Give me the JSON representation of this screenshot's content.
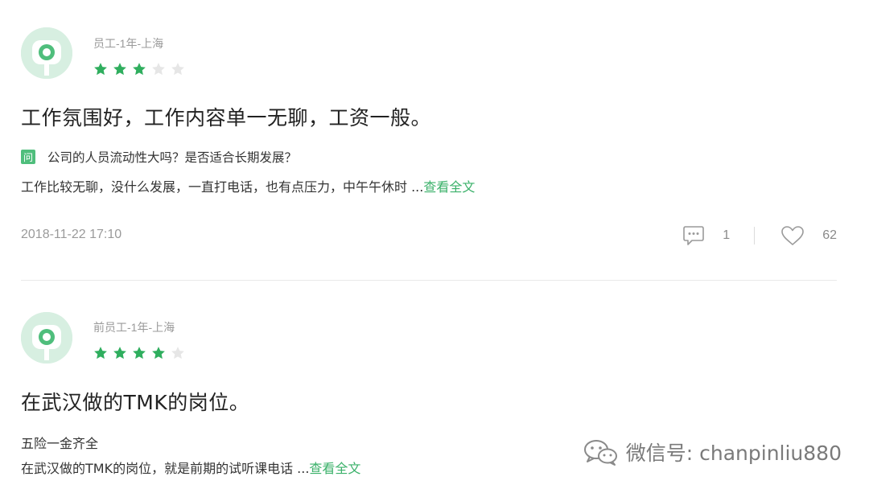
{
  "colors": {
    "accent": "#3bb16a",
    "star_on": "#2fae5e",
    "star_off": "#e6e6e6",
    "avatar_bg": "#d7efe1"
  },
  "reviews": [
    {
      "meta": "员工-1年-上海",
      "rating": 3,
      "rating_max": 5,
      "title": "工作氛围好，工作内容单一无聊，工资一般。",
      "question_badge": "问",
      "question": "公司的人员流动性大吗？是否适合长期发展？",
      "body": "工作比较无聊，没什么发展，一直打电话，也有点压力，中午午休时 ...",
      "more_link": "查看全文",
      "date": "2018-11-22 17:10",
      "comment_count": "1",
      "like_count": "62"
    },
    {
      "meta": "前员工-1年-上海",
      "rating": 4,
      "rating_max": 5,
      "title": "在武汉做的TMK的岗位。",
      "subhead": "五险一金齐全",
      "body": "在武汉做的TMK的岗位，就是前期的试听课电话 ...",
      "more_link": "查看全文"
    }
  ],
  "watermark": {
    "text": "微信号: chanpinliu880",
    "icon": "wechat-icon"
  }
}
